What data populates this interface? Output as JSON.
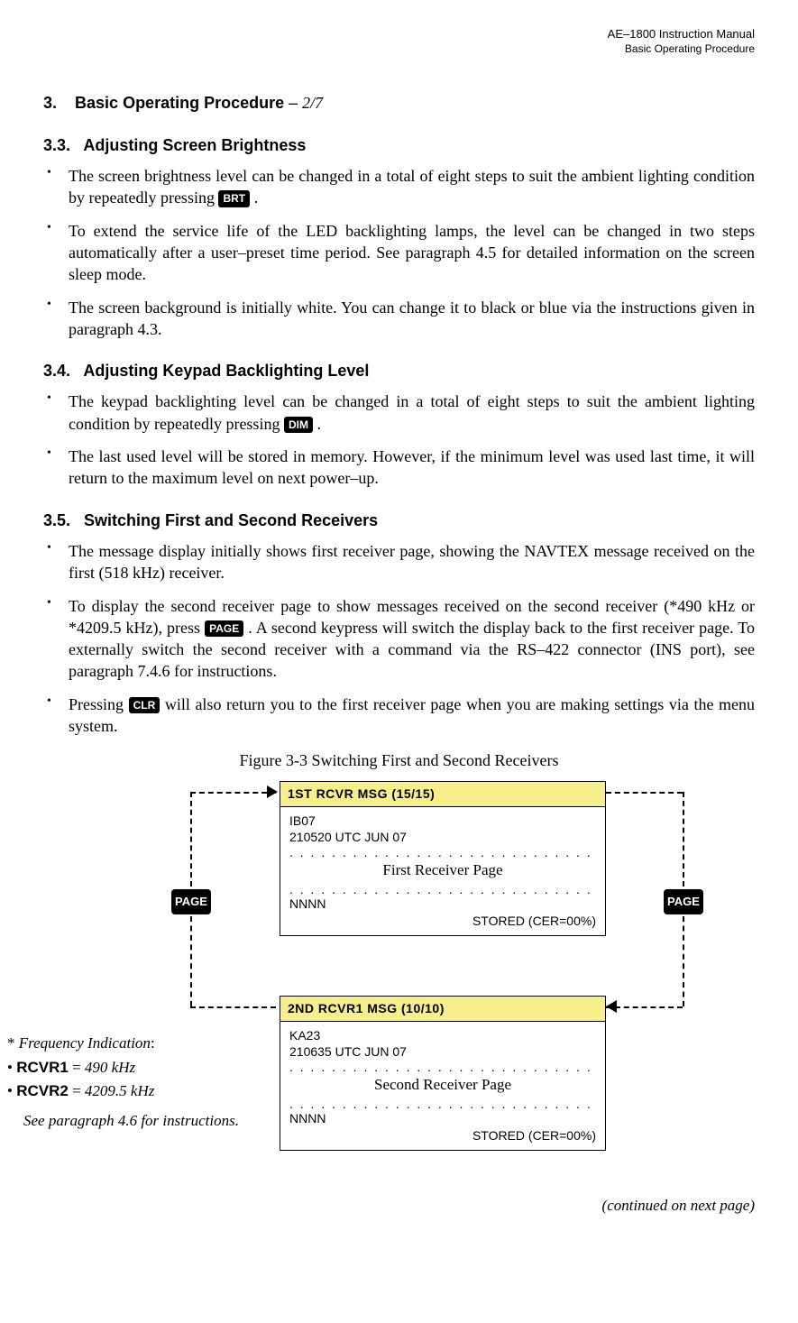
{
  "header": {
    "doc_title": "AE–1800 Instruction Manual",
    "section_name": "Basic Operating Procedure"
  },
  "section3": {
    "number": "3.",
    "title": "Basic Operating Procedure",
    "dash": "–",
    "pagefrac": "2/7"
  },
  "s33": {
    "num": "3.3.",
    "title": "Adjusting Screen Brightness",
    "b1a": "The screen brightness level can be changed in a total of eight steps to suit the ambient lighting condition by repeatedly pressing ",
    "key_brt": "BRT",
    "b1b": " .",
    "b2": "To extend the service life of the LED backlighting lamps, the level can be changed in two steps automatically after a user–preset time period. See paragraph 4.5 for detailed information on the screen sleep mode.",
    "b3": "The screen background is initially white. You can change it to black or blue via the instructions given in paragraph 4.3."
  },
  "s34": {
    "num": "3.4.",
    "title": "Adjusting Keypad Backlighting Level",
    "b1a": "The keypad backlighting level can be changed in a total of eight steps to suit the ambient lighting condition by repeatedly pressing ",
    "key_dim": "DIM",
    "b1b": " .",
    "b2": "The last used level will be stored in memory. However, if the minimum level was used last time, it will return to the maximum level on next power–up."
  },
  "s35": {
    "num": "3.5.",
    "title": "Switching First and Second Receivers",
    "b1": "The message display initially shows first receiver page, showing the NAVTEX message received on the first (518 kHz) receiver.",
    "b2a": "To display the second receiver page to show messages received on the second receiver (*490 kHz or *4209.5 kHz), press ",
    "key_page": "PAGE",
    "b2b": " .   A second keypress will switch the display back to the first receiver page. To externally switch the second receiver with a command via the RS–422 connector (INS port), see paragraph 7.4.6 for instructions.",
    "b3a": "Pressing ",
    "key_clr": "CLR",
    "b3b": " will also return you to the first receiver page when you are making settings via the menu system."
  },
  "figure": {
    "caption": "Figure 3-3   Switching First and Second Receivers",
    "key_page": "PAGE",
    "screen1": {
      "title": "1ST RCVR MSG (15/15)",
      "line1": "IB07",
      "line2": "210520 UTC JUN 07",
      "center": "First Receiver Page",
      "nnnn": "NNNN",
      "stored": "STORED  (CER=00%)"
    },
    "screen2": {
      "title": "2ND RCVR1 MSG (10/10)",
      "line1": "KA23",
      "line2": "210635 UTC JUN 07",
      "center": "Second Receiver Page",
      "nnnn": "NNNN",
      "stored": "STORED (CER=00%)"
    }
  },
  "footnote": {
    "star": "*",
    "freq_label": "Frequency Indication",
    "colon": ":",
    "rcvr1_label": "RCVR1",
    "rcvr1_eq": " = ",
    "rcvr1_val": "490 kHz",
    "rcvr2_label": "RCVR2",
    "rcvr2_eq": " = ",
    "rcvr2_val": "4209.5 kHz",
    "see": "See paragraph 4.6 for instructions."
  },
  "cont": "(continued on next page)"
}
